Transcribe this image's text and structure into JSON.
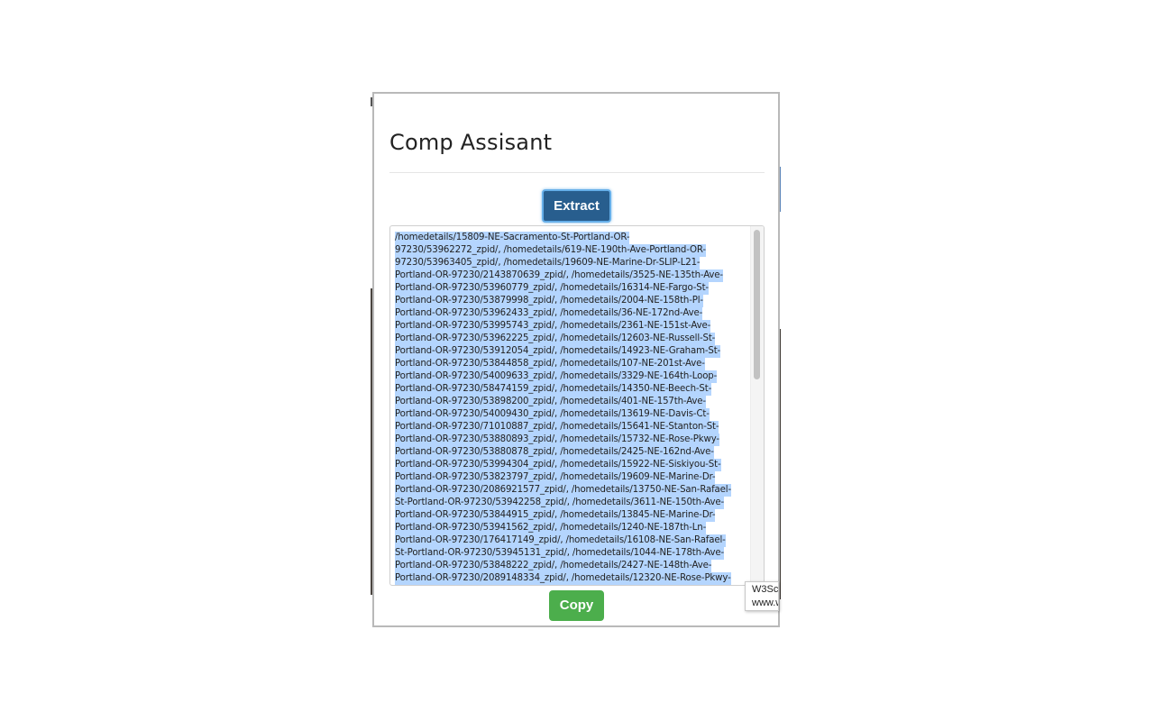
{
  "popup": {
    "title": "Comp Assisant",
    "extract_label": "Extract",
    "copy_label": "Copy",
    "textarea_lines": [
      "/homedetails/15809-NE-Sacramento-St-Portland-OR-",
      "97230/53962272_zpid/, /homedetails/619-NE-190th-Ave-Portland-OR-",
      "97230/53963405_zpid/, /homedetails/19609-NE-Marine-Dr-SLIP-L21-",
      "Portland-OR-97230/2143870639_zpid/, /homedetails/3525-NE-135th-Ave-",
      "Portland-OR-97230/53960779_zpid/, /homedetails/16314-NE-Fargo-St-",
      "Portland-OR-97230/53879998_zpid/, /homedetails/2004-NE-158th-Pl-",
      "Portland-OR-97230/53962433_zpid/, /homedetails/36-NE-172nd-Ave-",
      "Portland-OR-97230/53995743_zpid/, /homedetails/2361-NE-151st-Ave-",
      "Portland-OR-97230/53962225_zpid/, /homedetails/12603-NE-Russell-St-",
      "Portland-OR-97230/53912054_zpid/, /homedetails/14923-NE-Graham-St-",
      "Portland-OR-97230/53844858_zpid/, /homedetails/107-NE-201st-Ave-",
      "Portland-OR-97230/54009633_zpid/, /homedetails/3329-NE-164th-Loop-",
      "Portland-OR-97230/58474159_zpid/, /homedetails/14350-NE-Beech-St-",
      "Portland-OR-97230/53898200_zpid/, /homedetails/401-NE-157th-Ave-",
      "Portland-OR-97230/54009430_zpid/, /homedetails/13619-NE-Davis-Ct-",
      "Portland-OR-97230/71010887_zpid/, /homedetails/15641-NE-Stanton-St-",
      "Portland-OR-97230/53880893_zpid/, /homedetails/15732-NE-Rose-Pkwy-",
      "Portland-OR-97230/53880878_zpid/, /homedetails/2425-NE-162nd-Ave-",
      "Portland-OR-97230/53994304_zpid/, /homedetails/15922-NE-Siskiyou-St-",
      "Portland-OR-97230/53823797_zpid/, /homedetails/19609-NE-Marine-Dr-",
      "Portland-OR-97230/2086921577_zpid/, /homedetails/13750-NE-San-Rafael-",
      "St-Portland-OR-97230/53942258_zpid/, /homedetails/3611-NE-150th-Ave-",
      "Portland-OR-97230/53844915_zpid/, /homedetails/13845-NE-Marine-Dr-",
      "Portland-OR-97230/53941562_zpid/, /homedetails/1240-NE-187th-Ln-",
      "Portland-OR-97230/176417149_zpid/, /homedetails/16108-NE-San-Rafael-",
      "St-Portland-OR-97230/53945131_zpid/, /homedetails/1044-NE-178th-Ave-",
      "Portland-OR-97230/53848222_zpid/, /homedetails/2427-NE-148th-Ave-",
      "Portland-OR-97230/2089148334_zpid/, /homedetails/12320-NE-Rose-Pkwy-"
    ]
  },
  "tooltip": {
    "line1": "W3Sc",
    "line2": "www.w"
  },
  "colors": {
    "extract_bg": "#285e8e",
    "copy_bg": "#4cae4c",
    "selection": "#b4d5fe"
  }
}
